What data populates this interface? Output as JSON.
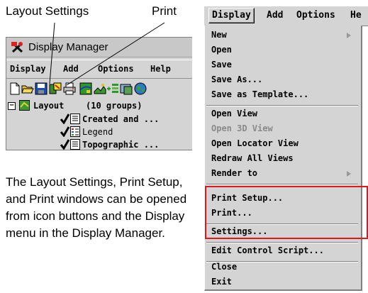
{
  "callouts": {
    "layout_settings": "Layout Settings",
    "print": "Print"
  },
  "display_manager": {
    "title": "Display Manager",
    "menubar": [
      "Display",
      "Add",
      "Options",
      "Help"
    ],
    "toolbar_icons": [
      "new-icon",
      "open-folder-icon",
      "save-icon",
      "layout-settings-icon",
      "print-icon",
      "map-icon",
      "group-icon",
      "layer-icon",
      "settings-icon",
      "globe-icon"
    ],
    "tree": {
      "root_label": "Layout",
      "root_count": "(10 groups)",
      "items": [
        "Created and ...",
        "Legend",
        "Topographic ..."
      ]
    }
  },
  "caption": "The Layout Settings, Print Setup, and Print windows can be opened from icon buttons and the Display menu in the Display Manager.",
  "menu": {
    "header": [
      "Display",
      "Add",
      "Options",
      "He"
    ],
    "items": {
      "new": "New",
      "open": "Open",
      "save": "Save",
      "save_as": "Save As...",
      "save_template": "Save as Template...",
      "open_view": "Open View",
      "open_3d_view": "Open 3D View",
      "open_locator_view": "Open Locator View",
      "redraw_all_views": "Redraw All Views",
      "render_to": "Render to",
      "print_setup": "Print Setup...",
      "print": "Print...",
      "settings": "Settings...",
      "edit_control_script": "Edit Control Script...",
      "close": "Close",
      "exit": "Exit"
    }
  },
  "colors": {
    "highlight": "#e0171c",
    "window_bg": "#d4d4d4",
    "disabled_text": "#8a8a8a"
  }
}
